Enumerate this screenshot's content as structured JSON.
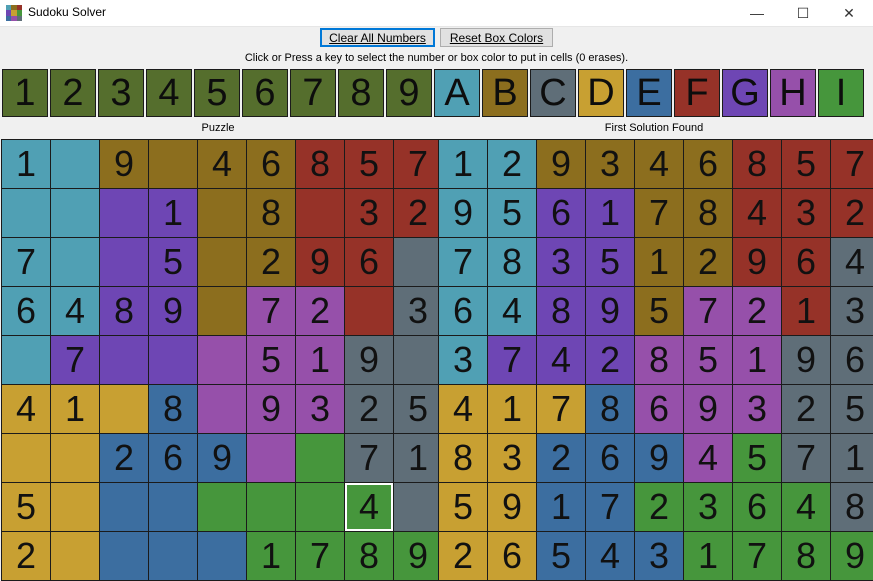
{
  "window": {
    "title": "Sudoku Solver",
    "minimize": "—",
    "maximize": "☐",
    "close": "✕"
  },
  "toolbar": {
    "clear_label": "Clear All Numbers",
    "reset_label": "Reset Box Colors",
    "instructions": "Click or Press a key to select the number or box color to put in cells (0 erases)."
  },
  "colors": {
    "A": "#50a0b4",
    "B": "#8c6e1e",
    "C": "#5f6e78",
    "D": "#c8a032",
    "E": "#3c6ea0",
    "F": "#963228",
    "G": "#6e46b4",
    "H": "#9650aa",
    "I": "#46963c",
    "number_button": "#556e2d",
    "selection_border": "#ffffff"
  },
  "palette": [
    "1",
    "2",
    "3",
    "4",
    "5",
    "6",
    "7",
    "8",
    "9",
    "A",
    "B",
    "C",
    "D",
    "E",
    "F",
    "G",
    "H",
    "I"
  ],
  "puzzle": {
    "label": "Puzzle",
    "values": [
      [
        "1",
        "",
        "9",
        "",
        "4",
        "6",
        "8",
        "5",
        "7"
      ],
      [
        "",
        "",
        "",
        "1",
        "",
        "8",
        "",
        "3",
        "2"
      ],
      [
        "7",
        "",
        "",
        "5",
        "",
        "2",
        "9",
        "6",
        ""
      ],
      [
        "6",
        "4",
        "8",
        "9",
        "",
        "7",
        "2",
        "",
        "3"
      ],
      [
        "",
        "7",
        "",
        "",
        "",
        "5",
        "1",
        "9",
        ""
      ],
      [
        "4",
        "1",
        "",
        "8",
        "",
        "9",
        "3",
        "2",
        "5"
      ],
      [
        "",
        "",
        "2",
        "6",
        "9",
        "",
        "",
        "7",
        "1"
      ],
      [
        "5",
        "",
        "",
        "",
        "",
        "",
        "",
        "4",
        ""
      ],
      [
        "2",
        "",
        "",
        "",
        "",
        "1",
        "7",
        "8",
        "9"
      ]
    ],
    "selected_cell": "7,7"
  },
  "solution": {
    "label": "First Solution Found",
    "values": [
      [
        "1",
        "2",
        "9",
        "3",
        "4",
        "6",
        "8",
        "5",
        "7"
      ],
      [
        "9",
        "5",
        "6",
        "1",
        "7",
        "8",
        "4",
        "3",
        "2"
      ],
      [
        "7",
        "8",
        "3",
        "5",
        "1",
        "2",
        "9",
        "6",
        "4"
      ],
      [
        "6",
        "4",
        "8",
        "9",
        "5",
        "7",
        "2",
        "1",
        "3"
      ],
      [
        "3",
        "7",
        "4",
        "2",
        "8",
        "5",
        "1",
        "9",
        "6"
      ],
      [
        "4",
        "1",
        "7",
        "8",
        "6",
        "9",
        "3",
        "2",
        "5"
      ],
      [
        "8",
        "3",
        "2",
        "6",
        "9",
        "4",
        "5",
        "7",
        "1"
      ],
      [
        "5",
        "9",
        "1",
        "7",
        "2",
        "3",
        "6",
        "4",
        "8"
      ],
      [
        "2",
        "6",
        "5",
        "4",
        "3",
        "1",
        "7",
        "8",
        "9"
      ]
    ]
  },
  "regions": [
    "AABBBBFFF",
    "AAGGBBFFF",
    "AAGGBBFFC",
    "AAGGBHHFC",
    "AGGGHHHCC",
    "DDDEHHHCC",
    "DDEEEHICC",
    "DDEEIIIIC",
    "DDEEEIIII"
  ]
}
